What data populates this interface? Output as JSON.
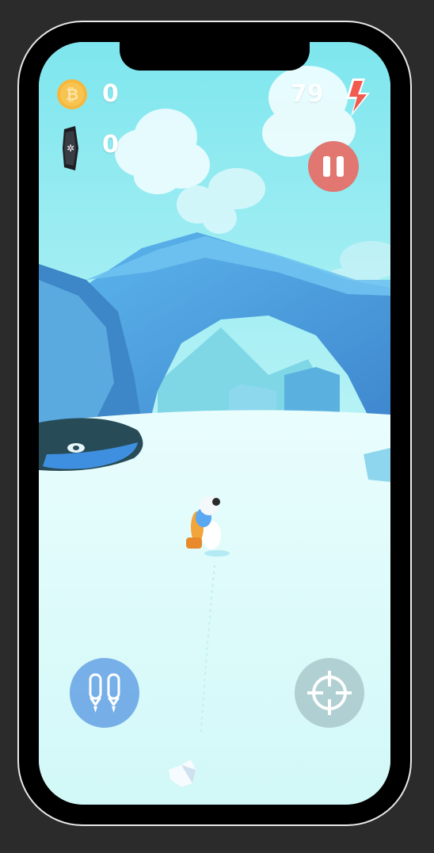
{
  "hud": {
    "coin_count": "0",
    "gem_count": "0",
    "energy_count": "79"
  },
  "icons": {
    "coin": "bitcoin-coin-icon",
    "gem": "snowflake-gem-icon",
    "energy": "lightning-bolt-icon",
    "pause": "pause-icon",
    "jetpack": "jetpack-icon",
    "target": "crosshair-icon",
    "snowball": "snowball-icon"
  },
  "colors": {
    "sky": "#6fe3ec",
    "ice": "#4f9fdc",
    "snow": "#dffbfb",
    "pause_button": "#e27671",
    "jetpack_button": "#5696e2",
    "target_button": "#a0bec2",
    "energy": "#f15a4e",
    "coin": "#f6b73c"
  }
}
